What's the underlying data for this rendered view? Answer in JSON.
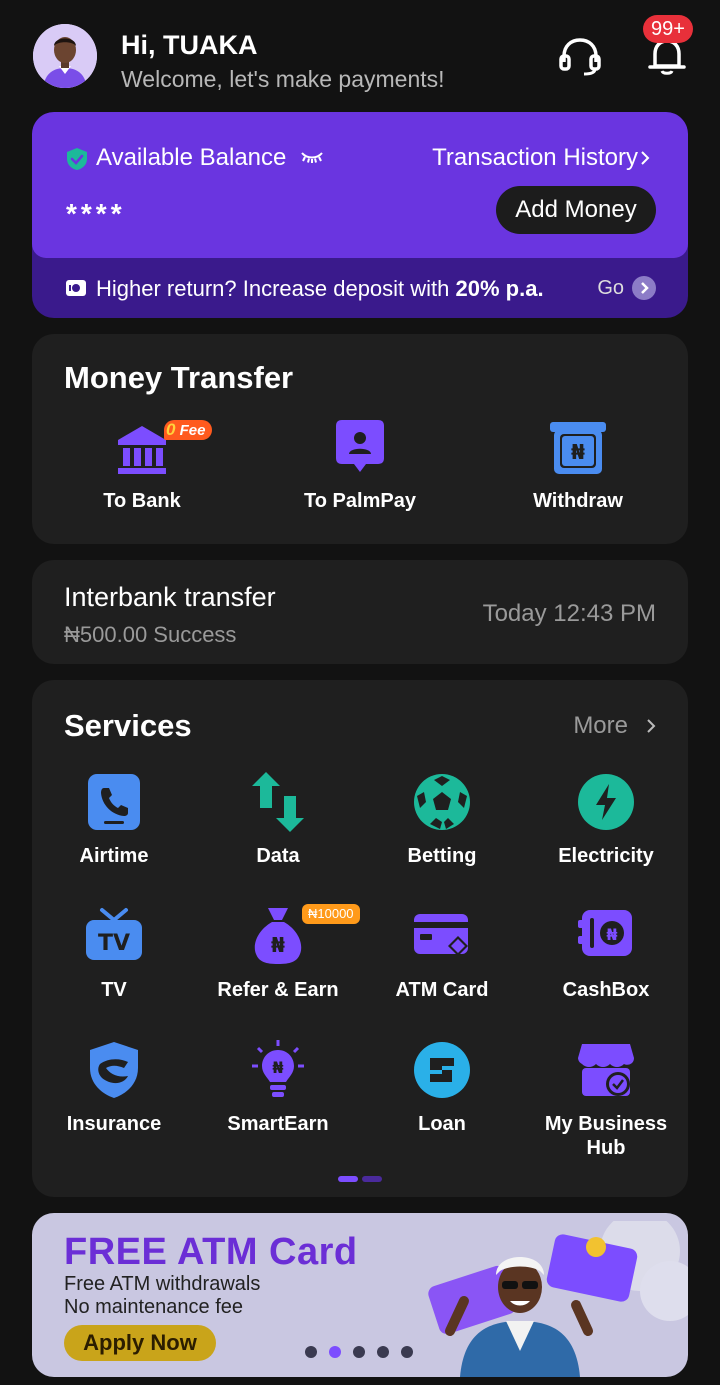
{
  "header": {
    "greeting": "Hi, TUAKA",
    "subtitle": "Welcome, let's make payments!",
    "notification_badge": "99+"
  },
  "balance": {
    "label": "Available Balance",
    "masked_amount": "****",
    "history_link": "Transaction History",
    "add_money_label": "Add Money",
    "promo_prefix": "Higher return? Increase deposit with ",
    "promo_highlight": "20% p.a.",
    "go_label": "Go"
  },
  "money_transfer": {
    "title": "Money Transfer",
    "zero_fee_badge_digit": "0",
    "zero_fee_badge_text": "Fee",
    "items": [
      {
        "label": "To Bank",
        "icon": "bank-icon"
      },
      {
        "label": "To PalmPay",
        "icon": "palmpay-user-icon"
      },
      {
        "label": "Withdraw",
        "icon": "withdraw-icon"
      }
    ]
  },
  "recent": {
    "title": "Interbank transfer",
    "detail": "₦500.00 Success",
    "time": "Today 12:43 PM"
  },
  "services": {
    "title": "Services",
    "more_label": "More",
    "bonus_tag": "₦10000",
    "items": [
      {
        "label": "Airtime",
        "icon": "phone-icon"
      },
      {
        "label": "Data",
        "icon": "data-arrows-icon"
      },
      {
        "label": "Betting",
        "icon": "football-icon"
      },
      {
        "label": "Electricity",
        "icon": "lightning-icon"
      },
      {
        "label": "TV",
        "icon": "tv-icon"
      },
      {
        "label": "Refer & Earn",
        "icon": "money-bag-icon"
      },
      {
        "label": "ATM Card",
        "icon": "atm-card-icon"
      },
      {
        "label": "CashBox",
        "icon": "safe-icon"
      },
      {
        "label": "Insurance",
        "icon": "shield-icon"
      },
      {
        "label": "SmartEarn",
        "icon": "bulb-icon"
      },
      {
        "label": "Loan",
        "icon": "loan-icon"
      },
      {
        "label": "My Business Hub",
        "icon": "store-icon"
      }
    ]
  },
  "banner": {
    "title": "FREE ATM Card",
    "line1": "Free ATM withdrawals",
    "line2": "No maintenance fee",
    "cta": "Apply Now",
    "slide_count": 5,
    "active_slide": 2
  },
  "colors": {
    "background": "#121212",
    "card": "#1f1f1f",
    "primary_purple": "#6a35e0",
    "promo_purple": "#3a1a8c",
    "accent_blue": "#4a8cf0",
    "accent_green": "#1cb99a",
    "service_purple": "#7c4dff",
    "badge_red": "#e8303a"
  }
}
